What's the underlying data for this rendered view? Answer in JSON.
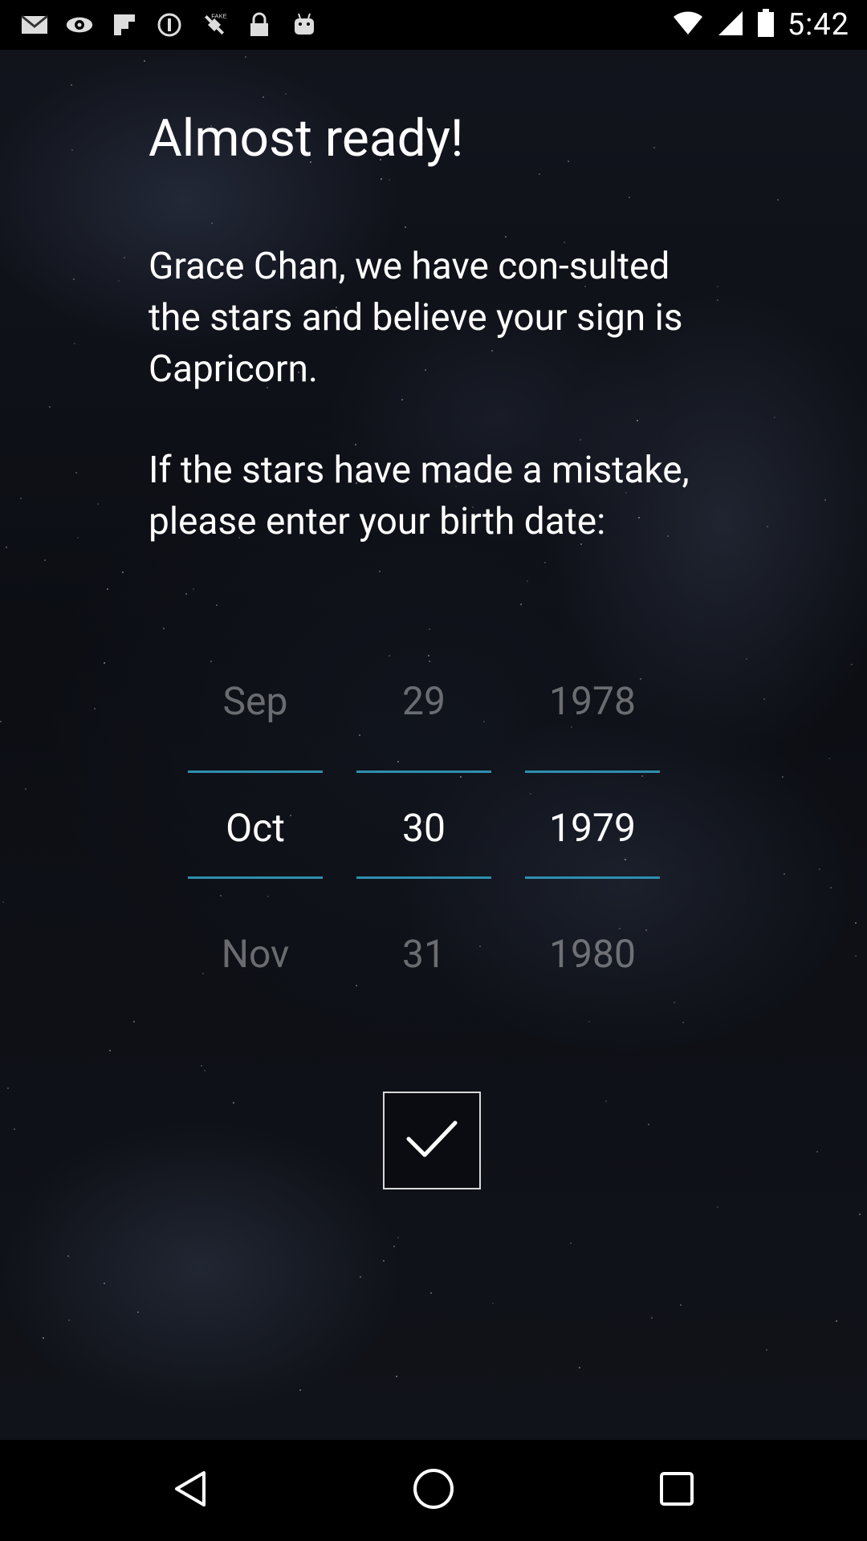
{
  "status_bar": {
    "time": "5:42",
    "icons": [
      "email-icon",
      "eye-icon",
      "flipboard-icon",
      "record-icon",
      "fake-gps-icon",
      "lock-icon",
      "android-icon",
      "wifi-icon",
      "signal-icon",
      "battery-icon"
    ]
  },
  "screen": {
    "title": "Almost ready!",
    "message_line1": "Grace Chan, we have con-sulted the stars and believe your sign is Capricorn.",
    "message_line2": "If the stars have made a mistake, please enter your birth date:"
  },
  "date_picker": {
    "month": {
      "prev": "Sep",
      "current": "Oct",
      "next": "Nov"
    },
    "day": {
      "prev": "29",
      "current": "30",
      "next": "31"
    },
    "year": {
      "prev": "1978",
      "current": "1979",
      "next": "1980"
    },
    "accent_color": "#2f8fb0"
  },
  "actions": {
    "confirm_icon": "checkmark-icon"
  },
  "navigation": {
    "back_icon": "back-triangle-icon",
    "home_icon": "home-circle-icon",
    "recent_icon": "recent-apps-square-icon"
  }
}
